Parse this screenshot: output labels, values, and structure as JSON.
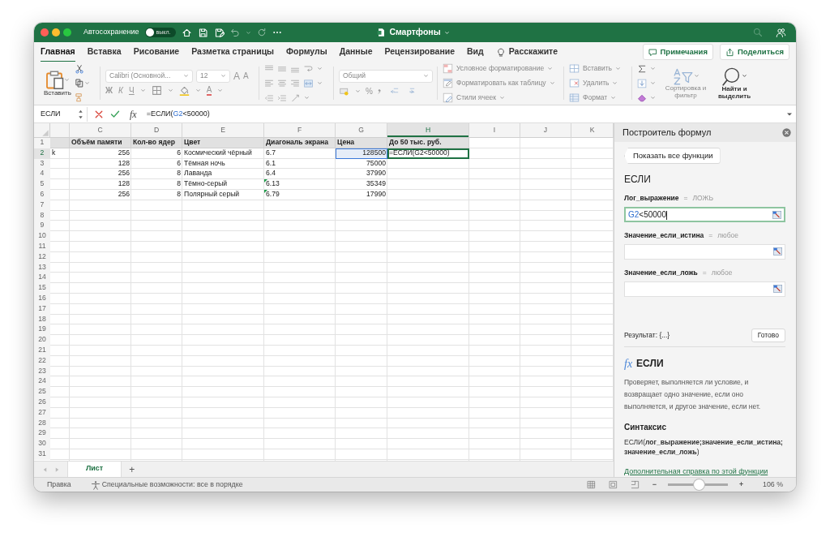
{
  "window": {
    "title": "Смартфоны",
    "autosave_label": "Автосохранение",
    "autosave": {
      "on": false,
      "label": "выкл."
    }
  },
  "ribbon_tabs": [
    {
      "label": "Главная",
      "selected": true
    },
    {
      "label": "Вставка",
      "selected": false
    },
    {
      "label": "Рисование",
      "selected": false
    },
    {
      "label": "Разметка страницы",
      "selected": false
    },
    {
      "label": "Формулы",
      "selected": false
    },
    {
      "label": "Данные",
      "selected": false
    },
    {
      "label": "Рецензирование",
      "selected": false
    },
    {
      "label": "Вид",
      "selected": false
    }
  ],
  "tell_me": "Расскажите",
  "header_buttons": [
    {
      "label": "Примечания",
      "kind": "comments"
    },
    {
      "label": "Поделиться",
      "kind": "share"
    }
  ],
  "ribbon": {
    "paste": "Вставить",
    "font_name": "Calibri (Основной...",
    "font_size": "12",
    "grow": "A",
    "shrink": "A",
    "bold": "Ж",
    "italic": "К",
    "underline": "Ч",
    "font_color": "A",
    "number_format": "Общий",
    "percent": "%",
    "styles": [
      {
        "label": "Условное форматирование",
        "kind": "conditional"
      },
      {
        "label": "Форматировать как таблицу",
        "kind": "table"
      },
      {
        "label": "Стили ячеек",
        "kind": "styles"
      }
    ],
    "cells": [
      {
        "label": "Вставить",
        "kind": "insert"
      },
      {
        "label": "Удалить",
        "kind": "delete"
      },
      {
        "label": "Формат",
        "kind": "format"
      }
    ],
    "sort": "Сортировка и фильтр",
    "find": "Найти и выделить"
  },
  "formula_bar": {
    "name_box": "ЕСЛИ",
    "fx": "fx",
    "formula": [
      {
        "text": "=ЕСЛИ(",
        "kind": "plain"
      },
      {
        "text": "G2",
        "kind": "ref"
      },
      {
        "text": "<50000)",
        "kind": "plain"
      }
    ]
  },
  "sheet": {
    "columns": [
      {
        "kind": "partial",
        "selected": false
      },
      {
        "label": "C",
        "kind": "number",
        "selected": false
      },
      {
        "label": "D",
        "kind": "number",
        "selected": false
      },
      {
        "label": "E",
        "kind": "text",
        "selected": false
      },
      {
        "label": "F",
        "kind": "text",
        "selected": false
      },
      {
        "label": "G",
        "kind": "number",
        "selected": false
      },
      {
        "label": "H",
        "kind": "text",
        "selected": true
      },
      {
        "label": "I",
        "kind": "text",
        "selected": false
      },
      {
        "label": "J",
        "kind": "text",
        "selected": false
      },
      {
        "label": "K",
        "kind": "text",
        "selected": false
      }
    ],
    "rows": [
      {
        "number": "1",
        "kind": "header",
        "selected": false,
        "cells": [
          null,
          "Объём памяти",
          "Кол-во ядер",
          "Цвет",
          "Диагональ экрана",
          "Цена",
          "До 50 тыс. руб."
        ]
      },
      {
        "number": "2",
        "kind": "data",
        "selected": true,
        "cells": [
          "k",
          "256",
          "6",
          "Космический чёрный",
          "6.7",
          {
            "text": "128500",
            "referenced": true
          },
          {
            "text": "=ЕСЛИ(G2<50000)",
            "active": true
          }
        ]
      },
      {
        "number": "3",
        "kind": "data",
        "selected": false,
        "cells": [
          null,
          "128",
          "6",
          "Тёмная ночь",
          "6.1",
          "75000"
        ]
      },
      {
        "number": "4",
        "kind": "data",
        "selected": false,
        "cells": [
          null,
          "256",
          "8",
          "Лаванда",
          "6.4",
          "37990"
        ]
      },
      {
        "number": "5",
        "kind": "data",
        "selected": false,
        "cells": [
          null,
          "128",
          "8",
          "Тёмно-серый",
          {
            "text": "6.13",
            "flag": true
          },
          "35349"
        ]
      },
      {
        "number": "6",
        "kind": "data",
        "selected": false,
        "cells": [
          null,
          "256",
          "8",
          "Полярный серый",
          {
            "text": "6.79",
            "flag": true
          },
          "17990"
        ]
      },
      {
        "number": "7",
        "selected": false
      },
      {
        "number": "8",
        "selected": false
      },
      {
        "number": "9",
        "selected": false
      },
      {
        "number": "10",
        "selected": false
      },
      {
        "number": "11",
        "selected": false
      },
      {
        "number": "12",
        "selected": false
      },
      {
        "number": "13",
        "selected": false
      },
      {
        "number": "14",
        "selected": false
      },
      {
        "number": "15",
        "selected": false
      },
      {
        "number": "16",
        "selected": false
      },
      {
        "number": "17",
        "selected": false
      },
      {
        "number": "18",
        "selected": false
      },
      {
        "number": "19",
        "selected": false
      },
      {
        "number": "20",
        "selected": false
      },
      {
        "number": "21",
        "selected": false
      },
      {
        "number": "22",
        "selected": false
      },
      {
        "number": "23",
        "selected": false
      },
      {
        "number": "24",
        "selected": false
      },
      {
        "number": "25",
        "selected": false
      },
      {
        "number": "26",
        "selected": false
      },
      {
        "number": "27",
        "selected": false
      },
      {
        "number": "28",
        "selected": false
      },
      {
        "number": "29",
        "selected": false
      },
      {
        "number": "30",
        "selected": false
      },
      {
        "number": "31",
        "selected": false
      }
    ]
  },
  "formula_builder": {
    "title": "Построитель формул",
    "show_all": "Показать все функции",
    "function": "ЕСЛИ",
    "args": [
      {
        "label": "Лог_выражение",
        "equals": "=",
        "hint": "ЛОЖЬ",
        "focused": true,
        "value": [
          {
            "text": "G2",
            "kind": "ref"
          },
          {
            "text": "<50000",
            "kind": "plain"
          }
        ]
      },
      {
        "label": "Значение_если_истина",
        "equals": "=",
        "hint": "любое",
        "focused": false
      },
      {
        "label": "Значение_если_ложь",
        "equals": "=",
        "hint": "любое",
        "focused": false
      }
    ],
    "result": "Результат: {...}",
    "done": "Готово",
    "help": {
      "fx": "fx",
      "title": "ЕСЛИ",
      "description": "Проверяет, выполняется ли условие, и возвращает одно значение, если оно выполняется, и другое значение, если нет.",
      "syntax_heading": "Синтаксис",
      "syntax": "ЕСЛИ(**лог_выражение;значение_если_истина;значение_если_ложь**)",
      "link": "Дополнительная справка по этой функции"
    }
  },
  "sheet_tabs": {
    "tabs": [
      {
        "label": "Лист",
        "selected": true
      }
    ],
    "add": "+"
  },
  "status_bar": {
    "mode": "Правка",
    "accessibility": "Специальные возможности: все в порядке",
    "zoom_out": "−",
    "zoom_in": "+",
    "zoom": {
      "level": 0.51
    },
    "zoom_label": "106 %"
  }
}
